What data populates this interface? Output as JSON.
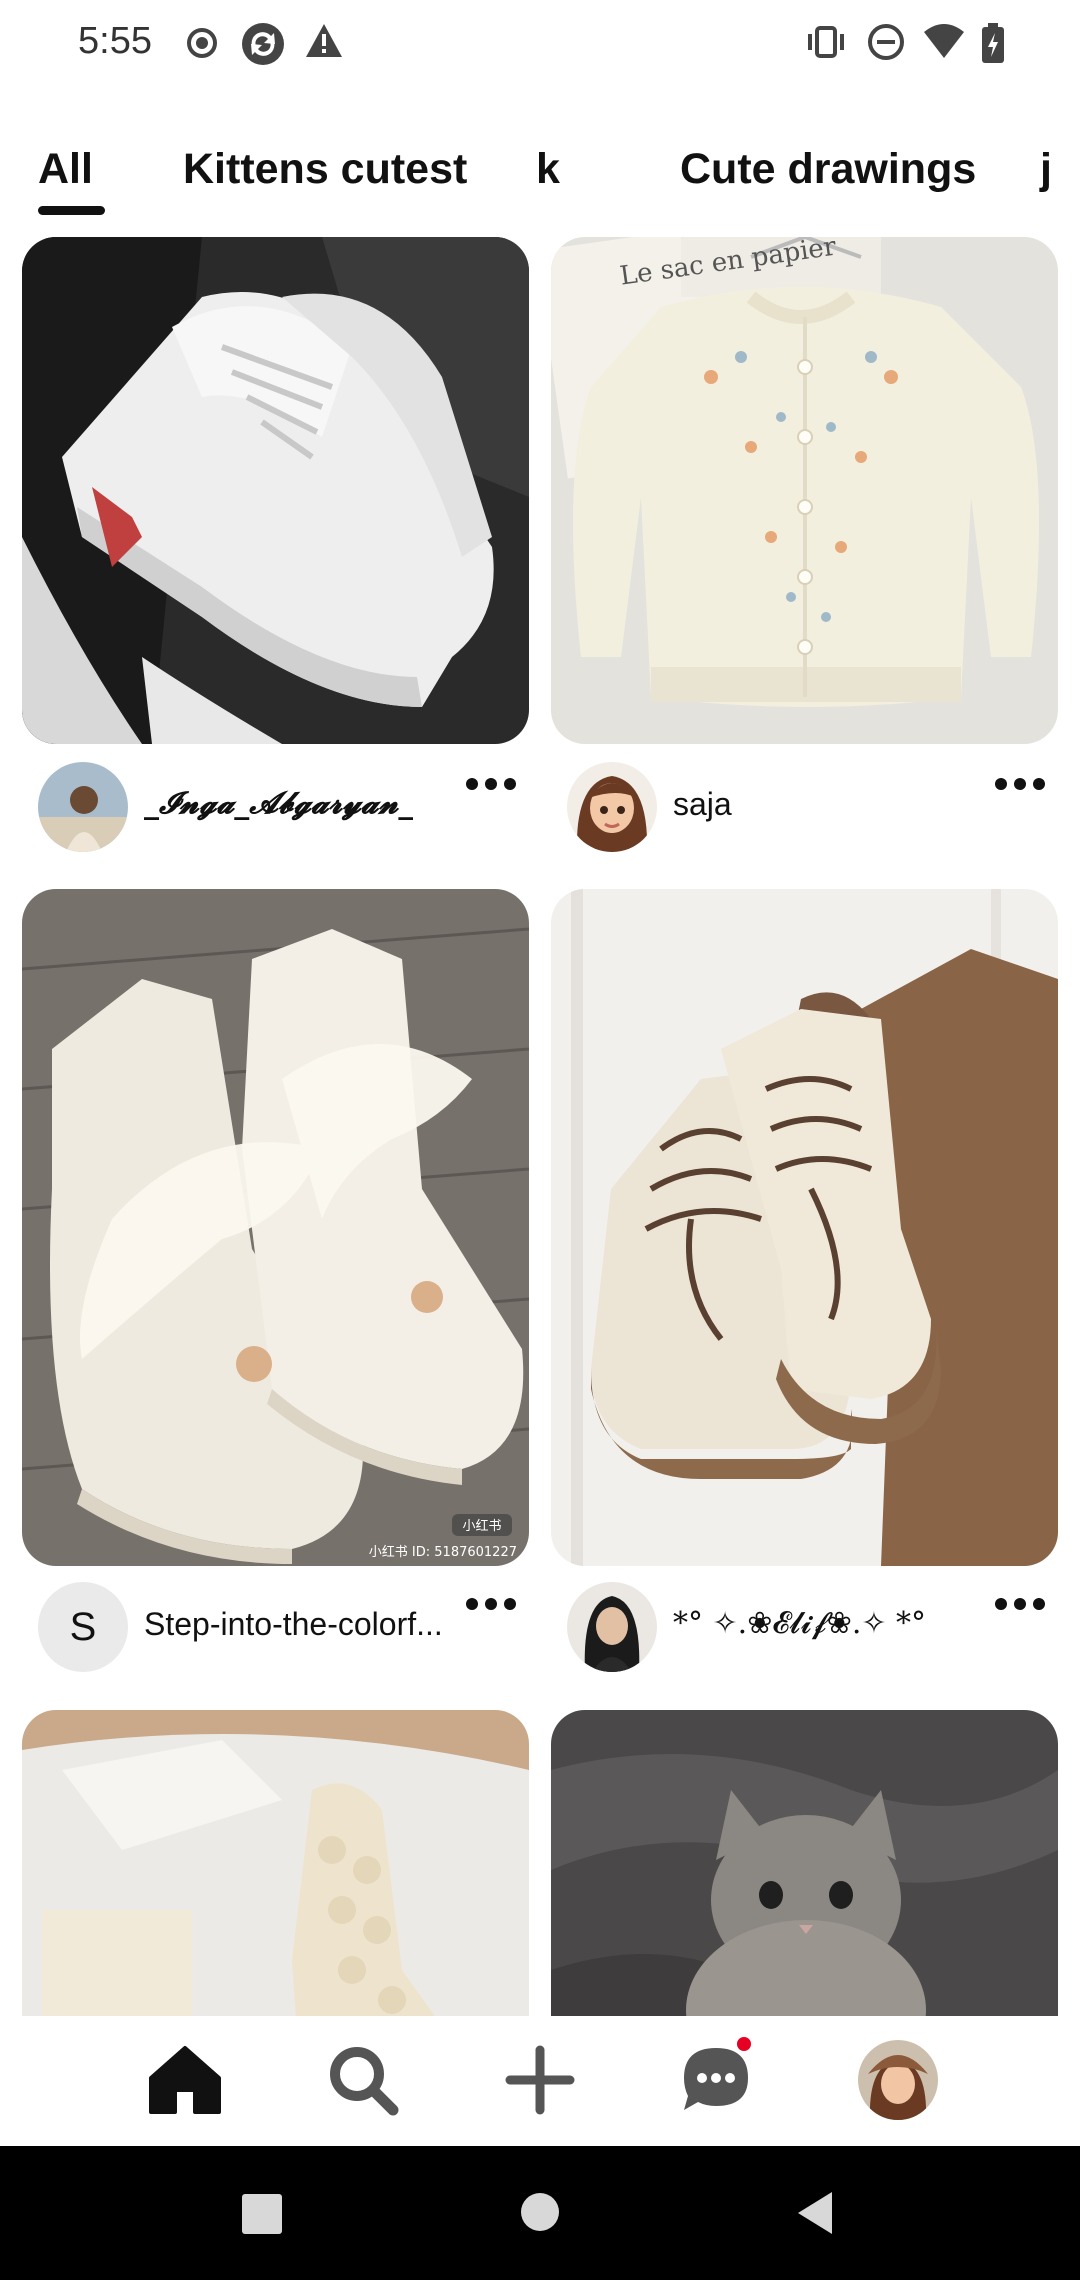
{
  "status_bar": {
    "time": "5:55",
    "left_icons": [
      "record-icon",
      "sync-icon",
      "warning-icon"
    ],
    "right_icons": [
      "vibrate-icon",
      "do-not-disturb-icon",
      "wifi-icon",
      "battery-icon"
    ]
  },
  "tabs": [
    {
      "label": "All",
      "selected": true
    },
    {
      "label": "Kittens cutest",
      "selected": false
    },
    {
      "label": "k",
      "selected": false
    },
    {
      "label": "Cute drawings",
      "selected": false
    },
    {
      "label": "j",
      "selected": false
    }
  ],
  "pins": [
    {
      "id": "sneakers-white",
      "author": "_𝓘𝓷𝓰𝓪_𝓐𝓫𝓰𝓪𝓻𝔂𝓪𝓷_",
      "avatar_initial": ""
    },
    {
      "id": "cardigan",
      "author": "saja",
      "avatar_initial": ""
    },
    {
      "id": "satin-hightops",
      "author": "Step-into-the-colorf...",
      "avatar_initial": "S",
      "watermark": "小红书 ID: 5187601227"
    },
    {
      "id": "brown-boots",
      "author": "*° ✧.❀𝓔𝓵𝓲𝓯❀.✧ *°",
      "avatar_initial": ""
    },
    {
      "id": "fur-boots",
      "author": "",
      "avatar_initial": ""
    },
    {
      "id": "kitten",
      "author": "",
      "avatar_initial": ""
    }
  ],
  "image_text": {
    "cardigan_tag": "Le sac en papier",
    "badge": "小红书"
  },
  "bottom_nav": {
    "items": [
      "home-icon",
      "search-icon",
      "create-icon",
      "messages-icon",
      "profile-avatar"
    ],
    "accent": "#e60023"
  },
  "system_nav": [
    "recents-button",
    "home-button",
    "back-button"
  ]
}
